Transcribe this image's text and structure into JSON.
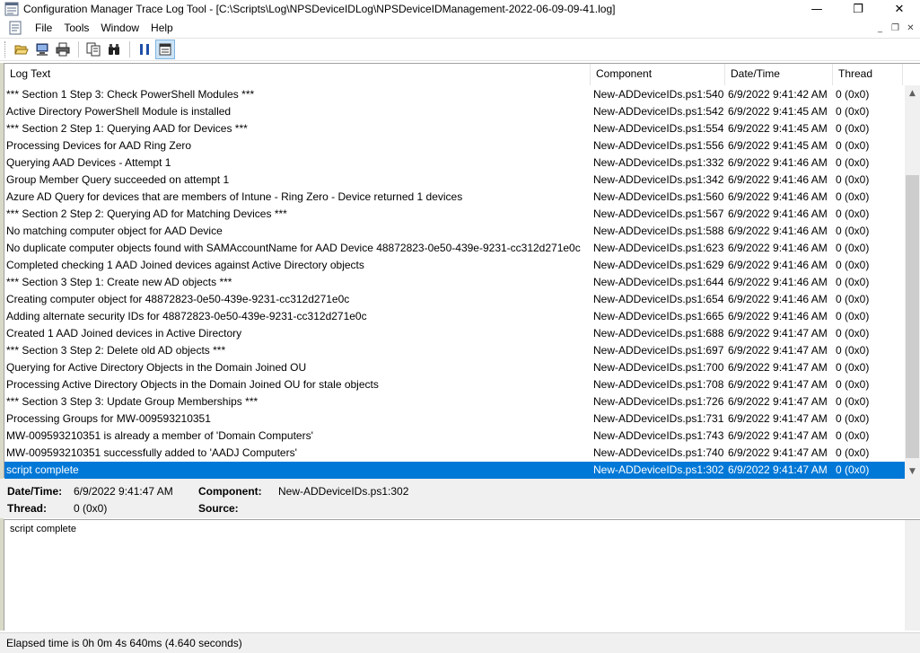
{
  "window": {
    "title": "Configuration Manager Trace Log Tool - [C:\\Scripts\\Log\\NPSDeviceIDLog\\NPSDeviceIDManagement-2022-06-09-09-41.log]",
    "controls": {
      "minimize": "—",
      "maximize": "❐",
      "close": "✕"
    }
  },
  "menu": {
    "items": [
      "File",
      "Tools",
      "Window",
      "Help"
    ],
    "mdi_controls": {
      "minimize": "_",
      "restore": "❐",
      "close": "✕"
    }
  },
  "toolbar": {
    "buttons": [
      "open-folder-icon",
      "open-remote-icon",
      "print-icon",
      "copy-icon",
      "find-icon",
      "pause-icon",
      "highlight-icon"
    ]
  },
  "grid": {
    "columns": [
      "Log Text",
      "Component",
      "Date/Time",
      "Thread"
    ],
    "rows": [
      {
        "text": "*** Section 1 Step 3: Check PowerShell Modules ***",
        "component": "New-ADDeviceIDs.ps1:540",
        "datetime": "6/9/2022 9:41:42 AM",
        "thread": "0 (0x0)"
      },
      {
        "text": "Active Directory PowerShell Module is installed",
        "component": "New-ADDeviceIDs.ps1:542",
        "datetime": "6/9/2022 9:41:45 AM",
        "thread": "0 (0x0)"
      },
      {
        "text": "*** Section 2 Step 1: Querying AAD for Devices ***",
        "component": "New-ADDeviceIDs.ps1:554",
        "datetime": "6/9/2022 9:41:45 AM",
        "thread": "0 (0x0)"
      },
      {
        "text": "Processing Devices for AAD Ring Zero",
        "component": "New-ADDeviceIDs.ps1:556",
        "datetime": "6/9/2022 9:41:45 AM",
        "thread": "0 (0x0)"
      },
      {
        "text": "Querying AAD Devices - Attempt 1",
        "component": "New-ADDeviceIDs.ps1:332",
        "datetime": "6/9/2022 9:41:46 AM",
        "thread": "0 (0x0)"
      },
      {
        "text": "Group Member Query succeeded on attempt 1",
        "component": "New-ADDeviceIDs.ps1:342",
        "datetime": "6/9/2022 9:41:46 AM",
        "thread": "0 (0x0)"
      },
      {
        "text": "Azure AD Query for devices that are members of Intune - Ring Zero - Device returned 1 devices",
        "component": "New-ADDeviceIDs.ps1:560",
        "datetime": "6/9/2022 9:41:46 AM",
        "thread": "0 (0x0)"
      },
      {
        "text": "*** Section 2 Step 2: Querying AD for Matching Devices ***",
        "component": "New-ADDeviceIDs.ps1:567",
        "datetime": "6/9/2022 9:41:46 AM",
        "thread": "0 (0x0)"
      },
      {
        "text": "No matching computer object for AAD Device",
        "component": "New-ADDeviceIDs.ps1:588",
        "datetime": "6/9/2022 9:41:46 AM",
        "thread": "0 (0x0)"
      },
      {
        "text": "No duplicate computer objects found with SAMAccountName  for AAD Device 48872823-0e50-439e-9231-cc312d271e0c",
        "component": "New-ADDeviceIDs.ps1:623",
        "datetime": "6/9/2022 9:41:46 AM",
        "thread": "0 (0x0)"
      },
      {
        "text": "Completed checking 1 AAD Joined devices against Active Directory objects",
        "component": "New-ADDeviceIDs.ps1:629",
        "datetime": "6/9/2022 9:41:46 AM",
        "thread": "0 (0x0)"
      },
      {
        "text": "*** Section 3 Step 1: Create new AD objects ***",
        "component": "New-ADDeviceIDs.ps1:644",
        "datetime": "6/9/2022 9:41:46 AM",
        "thread": "0 (0x0)"
      },
      {
        "text": "Creating computer object for 48872823-0e50-439e-9231-cc312d271e0c",
        "component": "New-ADDeviceIDs.ps1:654",
        "datetime": "6/9/2022 9:41:46 AM",
        "thread": "0 (0x0)"
      },
      {
        "text": "Adding alternate security IDs for 48872823-0e50-439e-9231-cc312d271e0c",
        "component": "New-ADDeviceIDs.ps1:665",
        "datetime": "6/9/2022 9:41:46 AM",
        "thread": "0 (0x0)"
      },
      {
        "text": "Created 1 AAD Joined devices in Active Directory",
        "component": "New-ADDeviceIDs.ps1:688",
        "datetime": "6/9/2022 9:41:47 AM",
        "thread": "0 (0x0)"
      },
      {
        "text": "*** Section 3 Step 2: Delete old AD objects ***",
        "component": "New-ADDeviceIDs.ps1:697",
        "datetime": "6/9/2022 9:41:47 AM",
        "thread": "0 (0x0)"
      },
      {
        "text": "Querying for Active Directory Objects in the Domain Joined OU",
        "component": "New-ADDeviceIDs.ps1:700",
        "datetime": "6/9/2022 9:41:47 AM",
        "thread": "0 (0x0)"
      },
      {
        "text": "Processing Active Directory Objects in the Domain Joined OU for stale objects",
        "component": "New-ADDeviceIDs.ps1:708",
        "datetime": "6/9/2022 9:41:47 AM",
        "thread": "0 (0x0)"
      },
      {
        "text": "*** Section 3 Step 3: Update Group Memberships ***",
        "component": "New-ADDeviceIDs.ps1:726",
        "datetime": "6/9/2022 9:41:47 AM",
        "thread": "0 (0x0)"
      },
      {
        "text": "Processing Groups for MW-009593210351",
        "component": "New-ADDeviceIDs.ps1:731",
        "datetime": "6/9/2022 9:41:47 AM",
        "thread": "0 (0x0)"
      },
      {
        "text": "MW-009593210351 is already a member of 'Domain Computers'",
        "component": "New-ADDeviceIDs.ps1:743",
        "datetime": "6/9/2022 9:41:47 AM",
        "thread": "0 (0x0)"
      },
      {
        "text": "MW-009593210351 successfully added to 'AADJ Computers'",
        "component": "New-ADDeviceIDs.ps1:740",
        "datetime": "6/9/2022 9:41:47 AM",
        "thread": "0 (0x0)"
      },
      {
        "text": "script complete",
        "component": "New-ADDeviceIDs.ps1:302",
        "datetime": "6/9/2022 9:41:47 AM",
        "thread": "0 (0x0)",
        "selected": true
      }
    ],
    "scroll": {
      "up": "▲",
      "down": "▼"
    }
  },
  "details": {
    "datetime_label": "Date/Time:",
    "datetime_value": "6/9/2022 9:41:47 AM",
    "component_label": "Component:",
    "component_value": "New-ADDeviceIDs.ps1:302",
    "thread_label": "Thread:",
    "thread_value": "0 (0x0)",
    "source_label": "Source:",
    "source_value": ""
  },
  "message": {
    "text": "script complete"
  },
  "status": {
    "text": "Elapsed time is 0h 0m 4s 640ms (4.640 seconds)"
  },
  "colors": {
    "selection": "#0078d7",
    "accent_pause": "#1f4fa8"
  }
}
